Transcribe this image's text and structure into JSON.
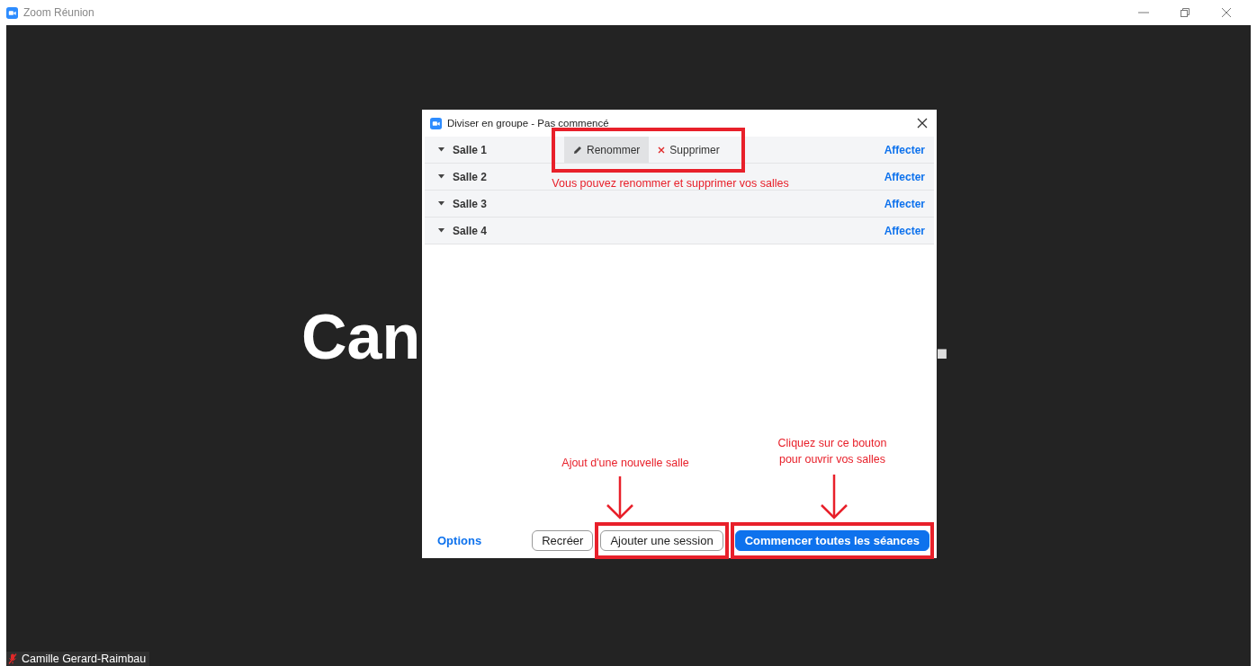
{
  "window": {
    "title": "Zoom Réunion"
  },
  "video": {
    "name_left": "Can",
    "name_right": ".",
    "label": "Camille Gerard-Raimbau",
    "muted": true
  },
  "dialog": {
    "title": "Diviser en groupe - Pas commencé",
    "rooms": [
      {
        "name": "Salle 1",
        "action": "Affecter",
        "tools": [
          {
            "label": "Renommer",
            "kind": "edit",
            "hovered": true
          },
          {
            "label": "Supprimer",
            "kind": "delete",
            "hovered": false
          }
        ]
      },
      {
        "name": "Salle 2",
        "action": "Affecter"
      },
      {
        "name": "Salle 3",
        "action": "Affecter"
      },
      {
        "name": "Salle 4",
        "action": "Affecter"
      }
    ],
    "options": "Options",
    "buttons": [
      {
        "label": "Recréer",
        "primary": false
      },
      {
        "label": "Ajouter une session",
        "primary": false
      },
      {
        "label": "Commencer toutes les séances",
        "primary": true
      }
    ]
  },
  "annotations": [
    {
      "text": "Vous pouvez renommer et supprimer vos salles"
    },
    {
      "text": "Ajout d'une nouvelle salle"
    },
    {
      "text": "Cliquez sur ce bouton\npour ouvrir vos salles"
    }
  ]
}
